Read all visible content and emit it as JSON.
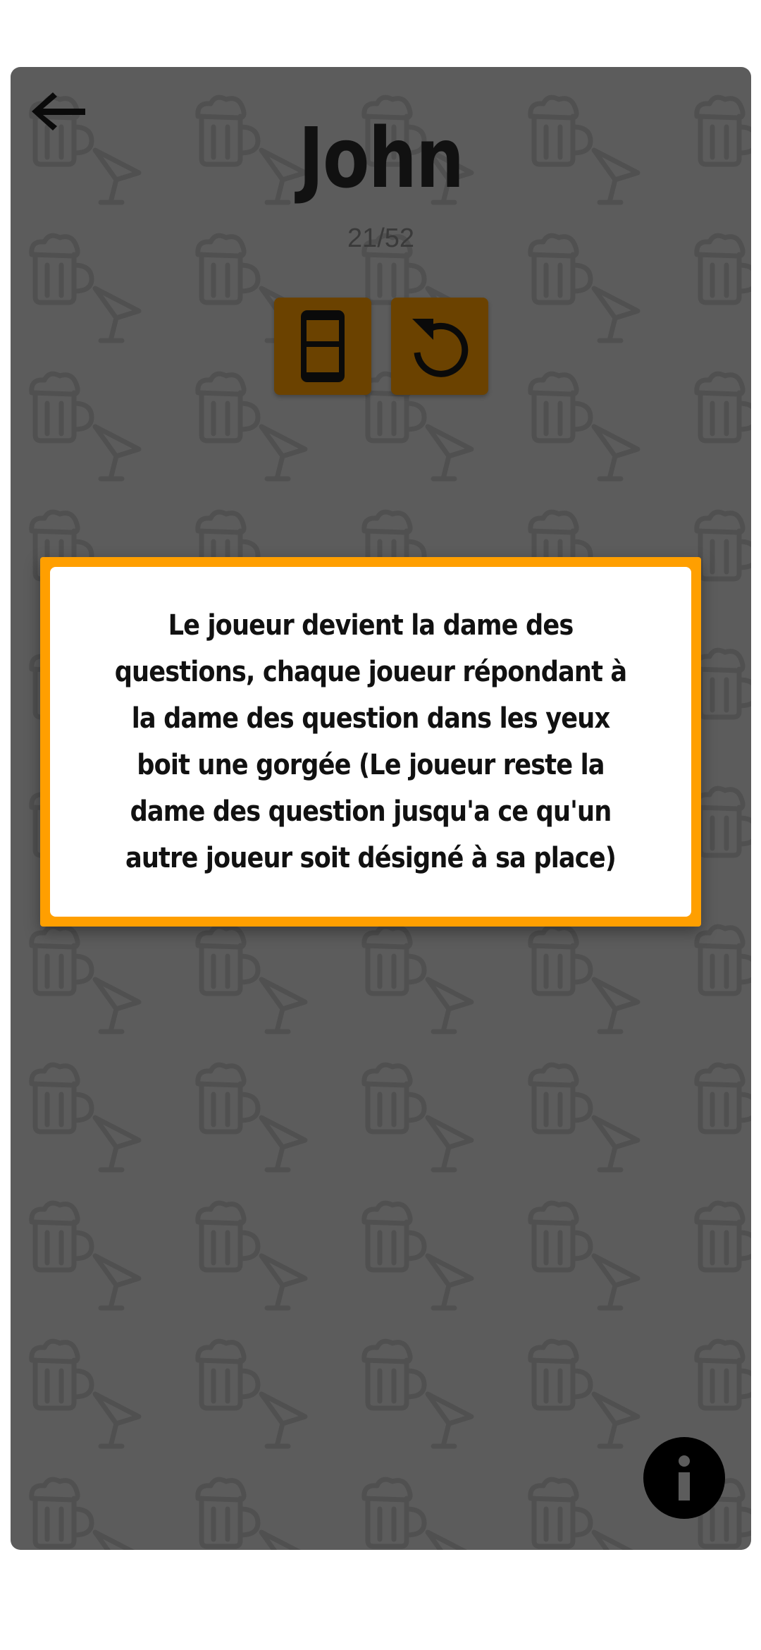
{
  "player": {
    "name": "John",
    "progress": "21/52"
  },
  "toolbar": {
    "back_icon": "arrow-left-icon",
    "phone_icon": "phone-icon",
    "reset_icon": "undo-icon"
  },
  "card": {
    "text": "Le joueur devient la dame des questions, chaque joueur répondant à la dame des question dans les yeux boit une gorgée (Le joueur reste la dame des question jusqu'a ce qu'un autre joueur soit désigné à sa place)"
  },
  "info": {
    "icon": "info-icon"
  },
  "colors": {
    "background": "#5c5c5c",
    "button": "#6b4200",
    "card_border": "#ff9f00"
  }
}
